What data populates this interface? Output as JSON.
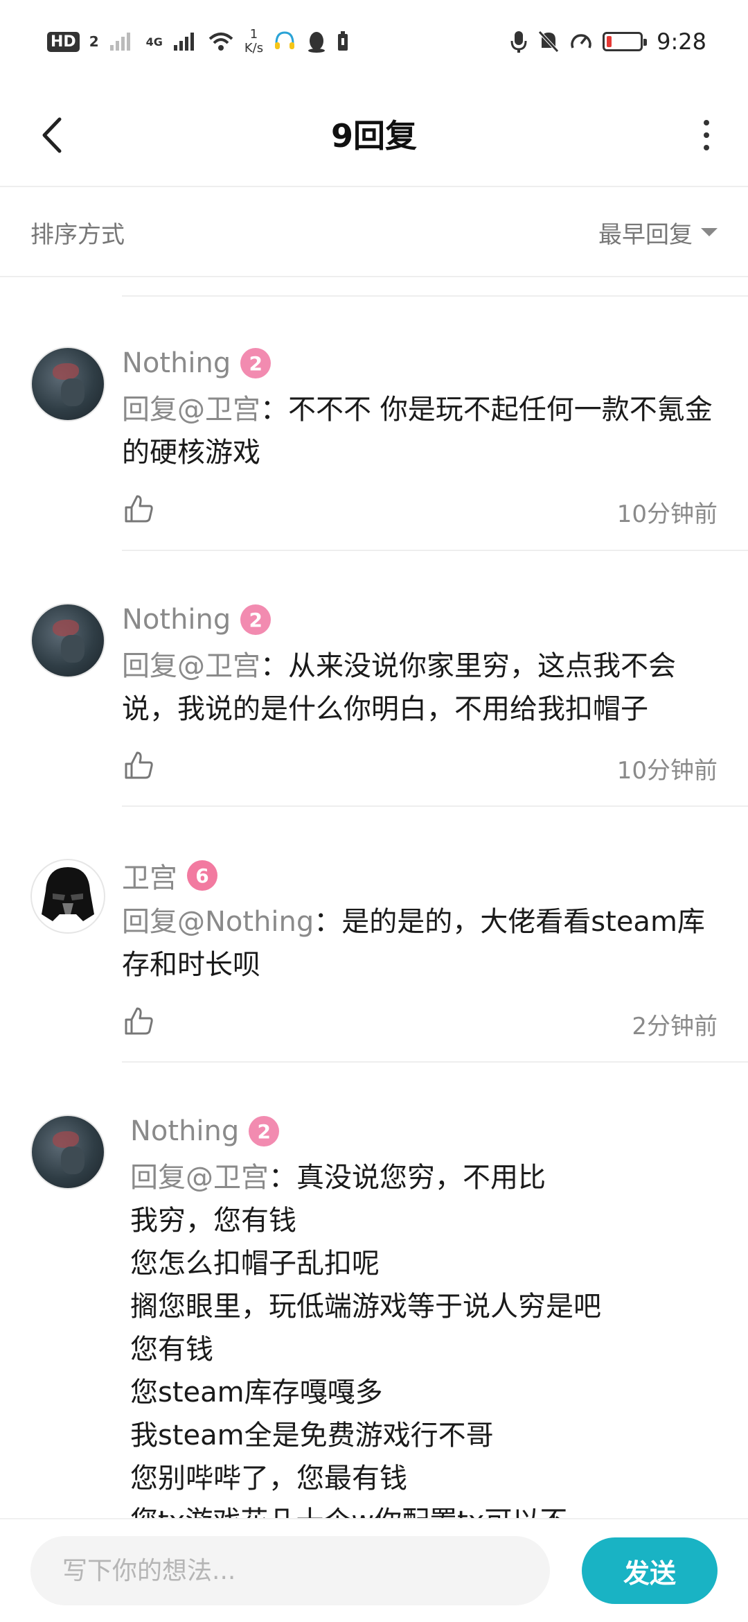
{
  "status_bar": {
    "hd_label": "HD",
    "sim_label": "2",
    "net_label": "4G",
    "speed_value": "1",
    "speed_unit": "K/s",
    "time": "9:28",
    "icons": [
      "hd-icon",
      "signal-icon",
      "wifi-icon",
      "headset-icon",
      "qq-icon",
      "battery-saver-icon",
      "mic-icon",
      "mute-icon",
      "speed-gauge-icon",
      "battery-icon"
    ],
    "battery_level": 0.1,
    "battery_color": "#e53935"
  },
  "header": {
    "title": "9回复"
  },
  "sort": {
    "label": "排序方式",
    "selected": "最早回复"
  },
  "comments": [
    {
      "name": "Nothing",
      "level": "2",
      "mention": "回复@卫宫",
      "text": "：不不不  你是玩不起任何一款不氪金的硬核游戏",
      "time": "10分钟前"
    },
    {
      "name": "Nothing",
      "level": "2",
      "mention": "回复@卫宫",
      "text": "：从来没说你家里穷，这点我不会说，我说的是什么你明白，不用给我扣帽子",
      "time": "10分钟前"
    },
    {
      "name": "卫宫",
      "level": "6",
      "mention": "回复@Nothing",
      "text": "：是的是的，大佬看看steam库存和时长呗",
      "time": "2分钟前"
    },
    {
      "name": "Nothing",
      "level": "2",
      "mention": "回复@卫宫",
      "text": "：真没说您穷，不用比\n我穷，您有钱\n您怎么扣帽子乱扣呢\n搁您眼里，玩低端游戏等于说人穷是吧\n您有钱\n您steam库存嘎嘎多\n我steam全是免费游戏行不哥\n您别哔哔了，您最有钱\n您tx游戏花几十个w你配置tx可以不"
    }
  ],
  "input": {
    "placeholder": "写下你的想法...",
    "send_label": "发送"
  },
  "colors": {
    "accent": "#19b3c4",
    "level_badge": "#f28bb0",
    "secondary_text": "#8a8a8a"
  }
}
